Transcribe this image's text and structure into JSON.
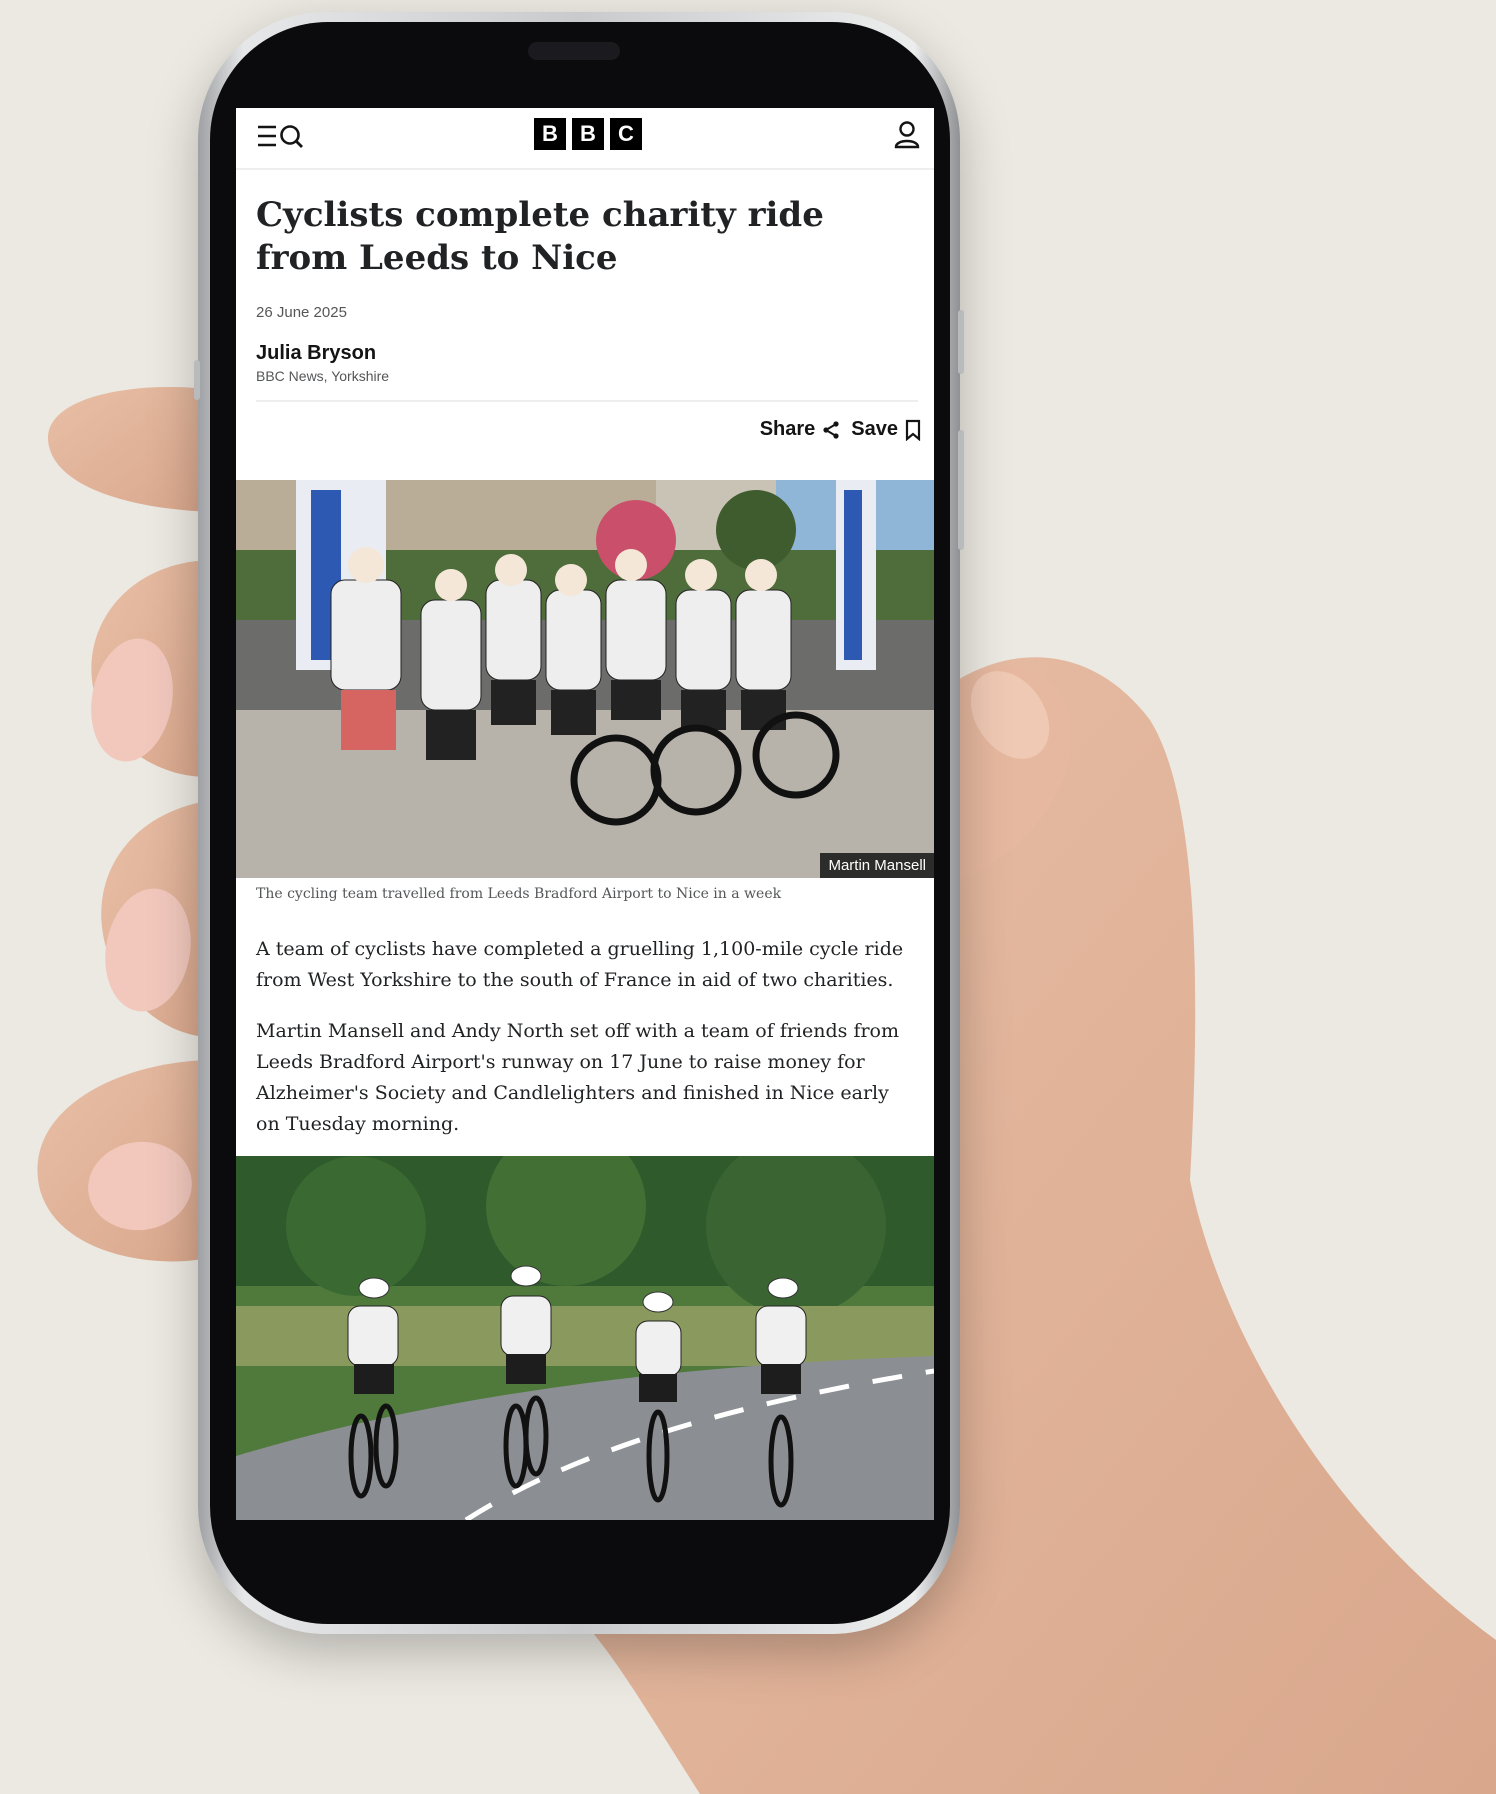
{
  "app": {
    "logo_letters": [
      "B",
      "B",
      "C"
    ]
  },
  "header": {
    "menu_icon": "menu-search-icon",
    "account_icon": "account-icon"
  },
  "article": {
    "headline": "Cyclists complete charity ride from Leeds to Nice",
    "date": "26 June 2025",
    "author": "Julia Bryson",
    "author_role": "BBC News, Yorkshire",
    "share_label": "Share",
    "save_label": "Save",
    "photo_credit": "Martin Mansell",
    "caption": "The cycling team travelled from Leeds Bradford Airport to Nice in a week",
    "paragraphs": [
      "A team of cyclists have completed a gruelling 1,100-mile cycle ride from West Yorkshire to the south of France in aid of two charities.",
      "Martin Mansell and Andy North set off with a team of friends from Leeds Bradford Airport's runway on 17 June to raise money for Alzheimer's Society and Candlelighters and finished in Nice early on Tuesday morning."
    ]
  },
  "colors": {
    "background": "#ECE9E2",
    "text_primary": "#202224",
    "text_secondary": "#545658",
    "brand_black": "#000000"
  }
}
